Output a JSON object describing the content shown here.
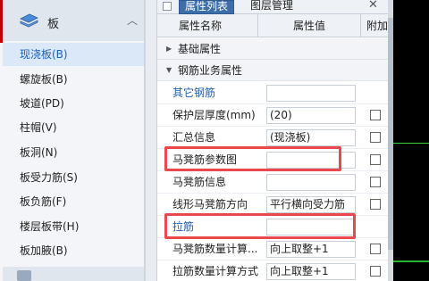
{
  "tree": {
    "category": "板",
    "items": [
      {
        "label": "现浇板(B)",
        "selected": true
      },
      {
        "label": "螺旋板(B)"
      },
      {
        "label": "坡道(PD)"
      },
      {
        "label": "柱帽(V)"
      },
      {
        "label": "板洞(N)"
      },
      {
        "label": "板受力筋(S)"
      },
      {
        "label": "板负筋(F)"
      },
      {
        "label": "楼层板带(H)"
      },
      {
        "label": "板加腋(B)"
      }
    ]
  },
  "panel": {
    "tabs": [
      "属性列表",
      "图层管理"
    ],
    "columns": [
      "属性名称",
      "属性值",
      "附加"
    ],
    "groups": [
      "基础属性",
      "钢筋业务属性"
    ],
    "rows": [
      {
        "name": "其它钢筋",
        "value": ""
      },
      {
        "name": "保护层厚度(mm)",
        "value": "(20)"
      },
      {
        "name": "汇总信息",
        "value": "(现浇板)"
      },
      {
        "name": "马凳筋参数图",
        "value": ""
      },
      {
        "name": "马凳筋信息",
        "value": ""
      },
      {
        "name": "线形马凳筋方向",
        "value": "平行横向受力筋"
      },
      {
        "name": "拉筋",
        "value": ""
      },
      {
        "name": "马凳筋数量计算...",
        "value": "向上取整+1"
      },
      {
        "name": "拉筋数量计算方式",
        "value": "向上取整+1"
      }
    ]
  },
  "colors": {
    "active_tab": "#3c6eaa",
    "highlight_box": "#e8484e",
    "link_text": "#1f5fb6",
    "canvas_bg": "#000000",
    "canvas_line": "#39d43a"
  },
  "icons": [
    "slab-icon",
    "chevron-up-icon",
    "pin-icon",
    "close-icon",
    "expand-arrow-icon",
    "collapse-arrow-icon"
  ]
}
